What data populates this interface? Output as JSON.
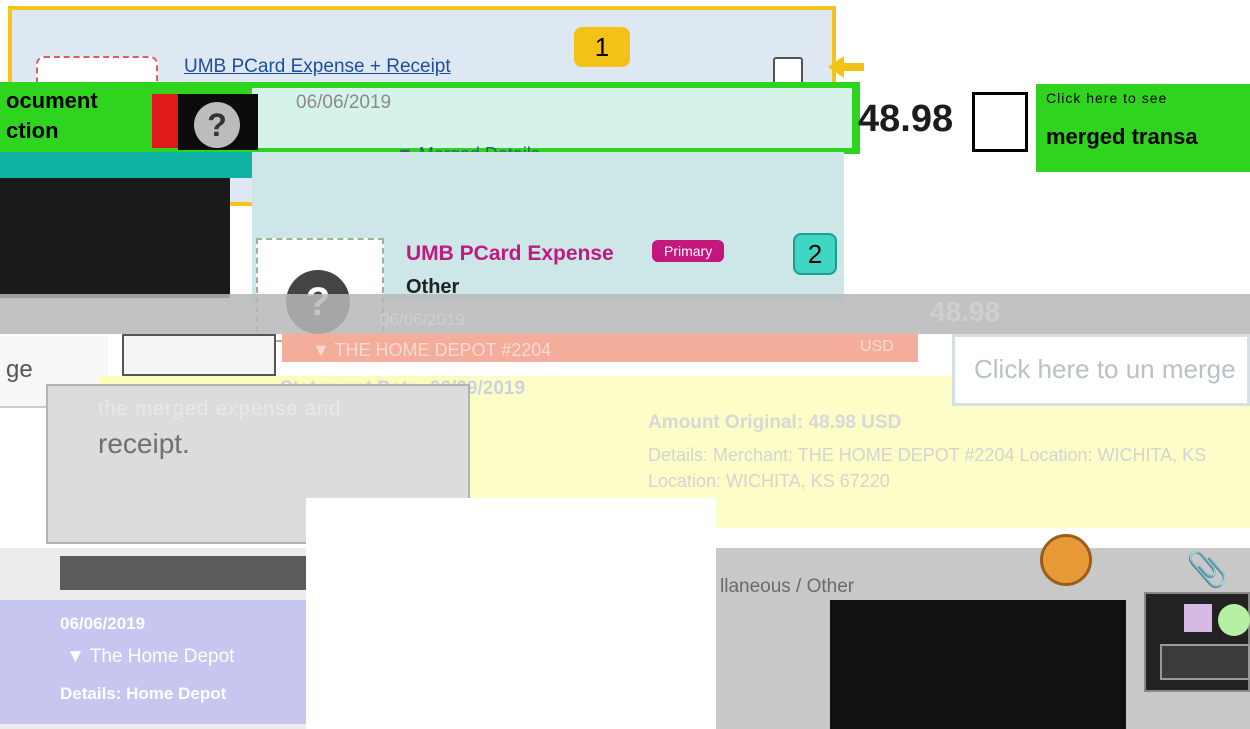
{
  "callouts": {
    "one": "1",
    "two": "2"
  },
  "top_card": {
    "title": "UMB PCard Expense + Receipt",
    "date": "06/06/2019",
    "merged_details": "Merged Details",
    "amount": "48.98"
  },
  "left_strip": {
    "line1": "ocument",
    "line2": "ction"
  },
  "right_strip": {
    "top": "Click here to see",
    "bottom": "merged transa"
  },
  "primary": {
    "title": "UMB PCard Expense",
    "badge": "Primary",
    "category": "Other",
    "date": "06/06/2019",
    "amount": "48.98",
    "merchant": "THE HOME DEPOT #2204",
    "currency": "USD"
  },
  "statement": "Statement Date: 06/09/2019",
  "amount_original": "Amount Original: 48.98 USD",
  "details": "Details: Merchant: THE HOME DEPOT #2204 Location: WICHITA, KS Location: WICHITA, KS 67220",
  "stage": "ge",
  "tooltip": {
    "line1": "the merged expense and",
    "line2": "receipt."
  },
  "unmerge": "Click here to un merge",
  "category_text": "llaneous / Other",
  "lower_left": {
    "date": "06/06/2019",
    "merchant": "The Home Depot",
    "details": "Details: Home Depot"
  },
  "icons": {
    "question": "?",
    "clip": "📎",
    "dropdown_arrow": "▼"
  }
}
